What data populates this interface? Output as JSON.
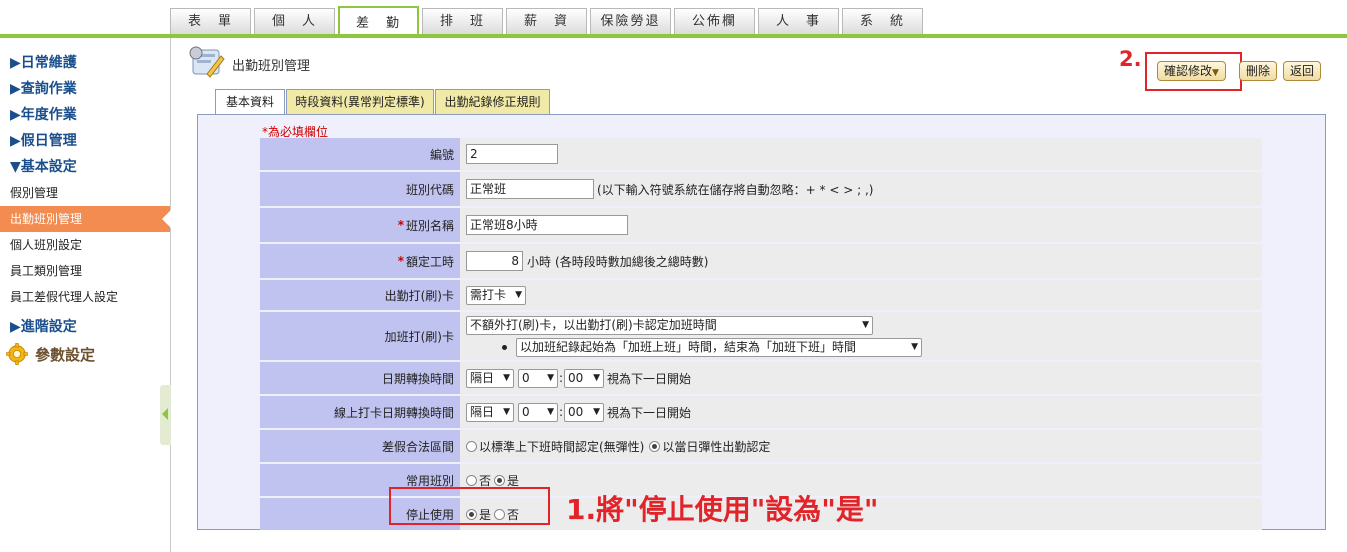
{
  "top_tabs": [
    "表　單",
    "個　人",
    "差　勤",
    "排　班",
    "薪　資",
    "保險勞退",
    "公佈欄",
    "人　事",
    "系　統"
  ],
  "sidebar": {
    "groups": [
      "▶日常維護",
      "▶查詢作業",
      "▶年度作業",
      "▶假日管理",
      "▼基本設定"
    ],
    "items": [
      "假別管理",
      "出勤班別管理",
      "個人班別設定",
      "員工類別管理",
      "員工差假代理人設定"
    ],
    "advanced": "▶進階設定",
    "params": "參數設定"
  },
  "page": {
    "title": "出勤班別管理",
    "buttons": {
      "confirm": "確認修改",
      "delete": "刪除",
      "back": "返回"
    },
    "tabs": [
      "基本資料",
      "時段資料(異常判定標準)",
      "出勤紀錄修正規則"
    ],
    "required_note": "*為必填欄位"
  },
  "form": {
    "code": {
      "label": "編號",
      "value": "2"
    },
    "shift_code": {
      "label": "班別代碼",
      "value": "正常班",
      "hint": "(以下輸入符號系統在儲存將自動忽略：+ * < > ; ,)"
    },
    "shift_name": {
      "label": "班別名稱",
      "value": "正常班8小時"
    },
    "hours": {
      "label": "額定工時",
      "value": "8",
      "unit": "小時",
      "hint": "(各時段時數加總後之總時數)"
    },
    "clock_in": {
      "label": "出勤打(刷)卡",
      "value": "需打卡"
    },
    "overtime": {
      "label": "加班打(刷)卡",
      "value": "不額外打(刷)卡，以出勤打(刷)卡認定加班時間",
      "sub_value": "以加班紀錄起始為「加班上班」時間，結束為「加班下班」時間"
    },
    "date_switch": {
      "label": "日期轉換時間",
      "day": "隔日",
      "hour": "0",
      "minute": "00",
      "suffix": "視為下一日開始"
    },
    "online_date_switch": {
      "label": "線上打卡日期轉換時間",
      "day": "隔日",
      "hour": "0",
      "minute": "00",
      "suffix": "視為下一日開始"
    },
    "leave_range": {
      "label": "差假合法區間",
      "opt1": "以標準上下班時間認定(無彈性)",
      "opt2": "以當日彈性出勤認定",
      "selected": 2
    },
    "common_shift": {
      "label": "常用班別",
      "no": "否",
      "yes": "是",
      "selected": "yes"
    },
    "disabled": {
      "label": "停止使用",
      "yes": "是",
      "no": "否",
      "selected": "yes"
    }
  },
  "callouts": {
    "step1": "1.將\"停止使用\"設為\"是\"",
    "step2": "2."
  },
  "colors": {
    "accent": "#8dc63f",
    "callout": "#e0242a",
    "active_menu": "#f28c50",
    "label_bg": "#c0c3ef"
  }
}
